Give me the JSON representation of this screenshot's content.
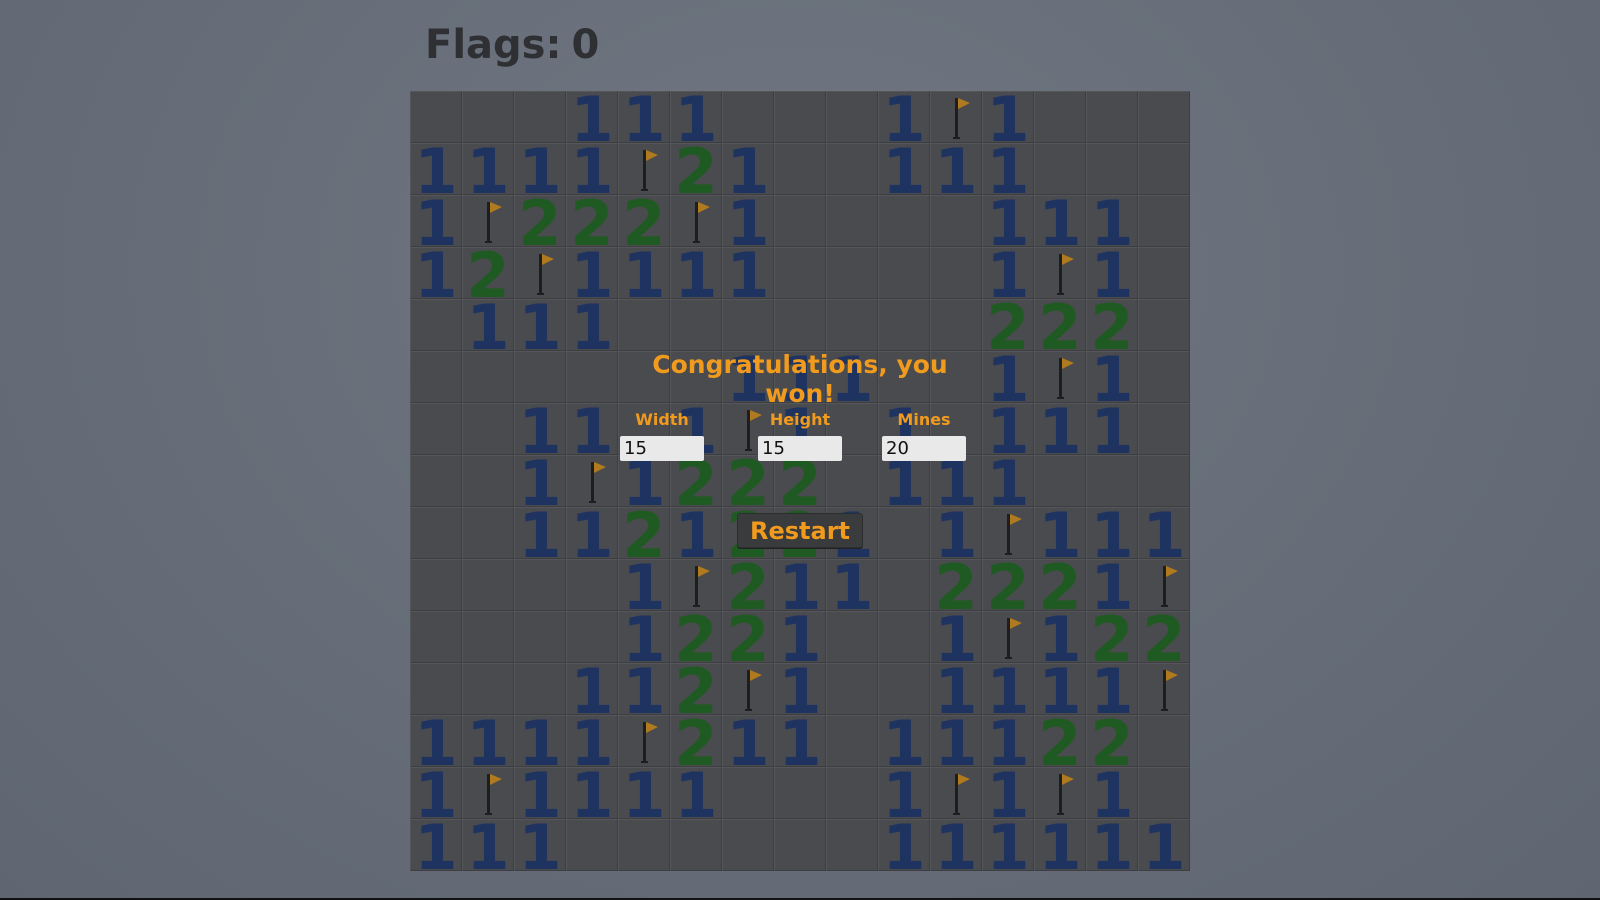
{
  "header": {
    "flags_label": "Flags:",
    "flags_count": "0"
  },
  "board": {
    "width": 15,
    "height": 15,
    "rows": [
      "   111   1F1   ",
      "1111F21  111   ",
      "1F222F1    111 ",
      "12F1111    1F1 ",
      " 111       222 ",
      "      111  1F1 ",
      "  11 1F1 1 111 ",
      "  1F1222 111   ",
      "  1121221 1F111",
      "    1F211 2221F",
      "    1221  1F122",
      "   112F1  1111F",
      "1111F211 11122 ",
      "1F1111   1F1F1 ",
      "111      111111"
    ],
    "colors": {
      "one": "#1f3360",
      "two": "#1f5a22",
      "flag": "#b07a1e",
      "pole": "#1e1e1e",
      "cell": "#4a4b4e"
    }
  },
  "dialog": {
    "message": "Congratulations, you won!",
    "width_label": "Width",
    "width_value": "15",
    "height_label": "Height",
    "height_value": "15",
    "mines_label": "Mines",
    "mines_value": "20",
    "restart_label": "Restart",
    "accent_color": "#f09a1e"
  }
}
